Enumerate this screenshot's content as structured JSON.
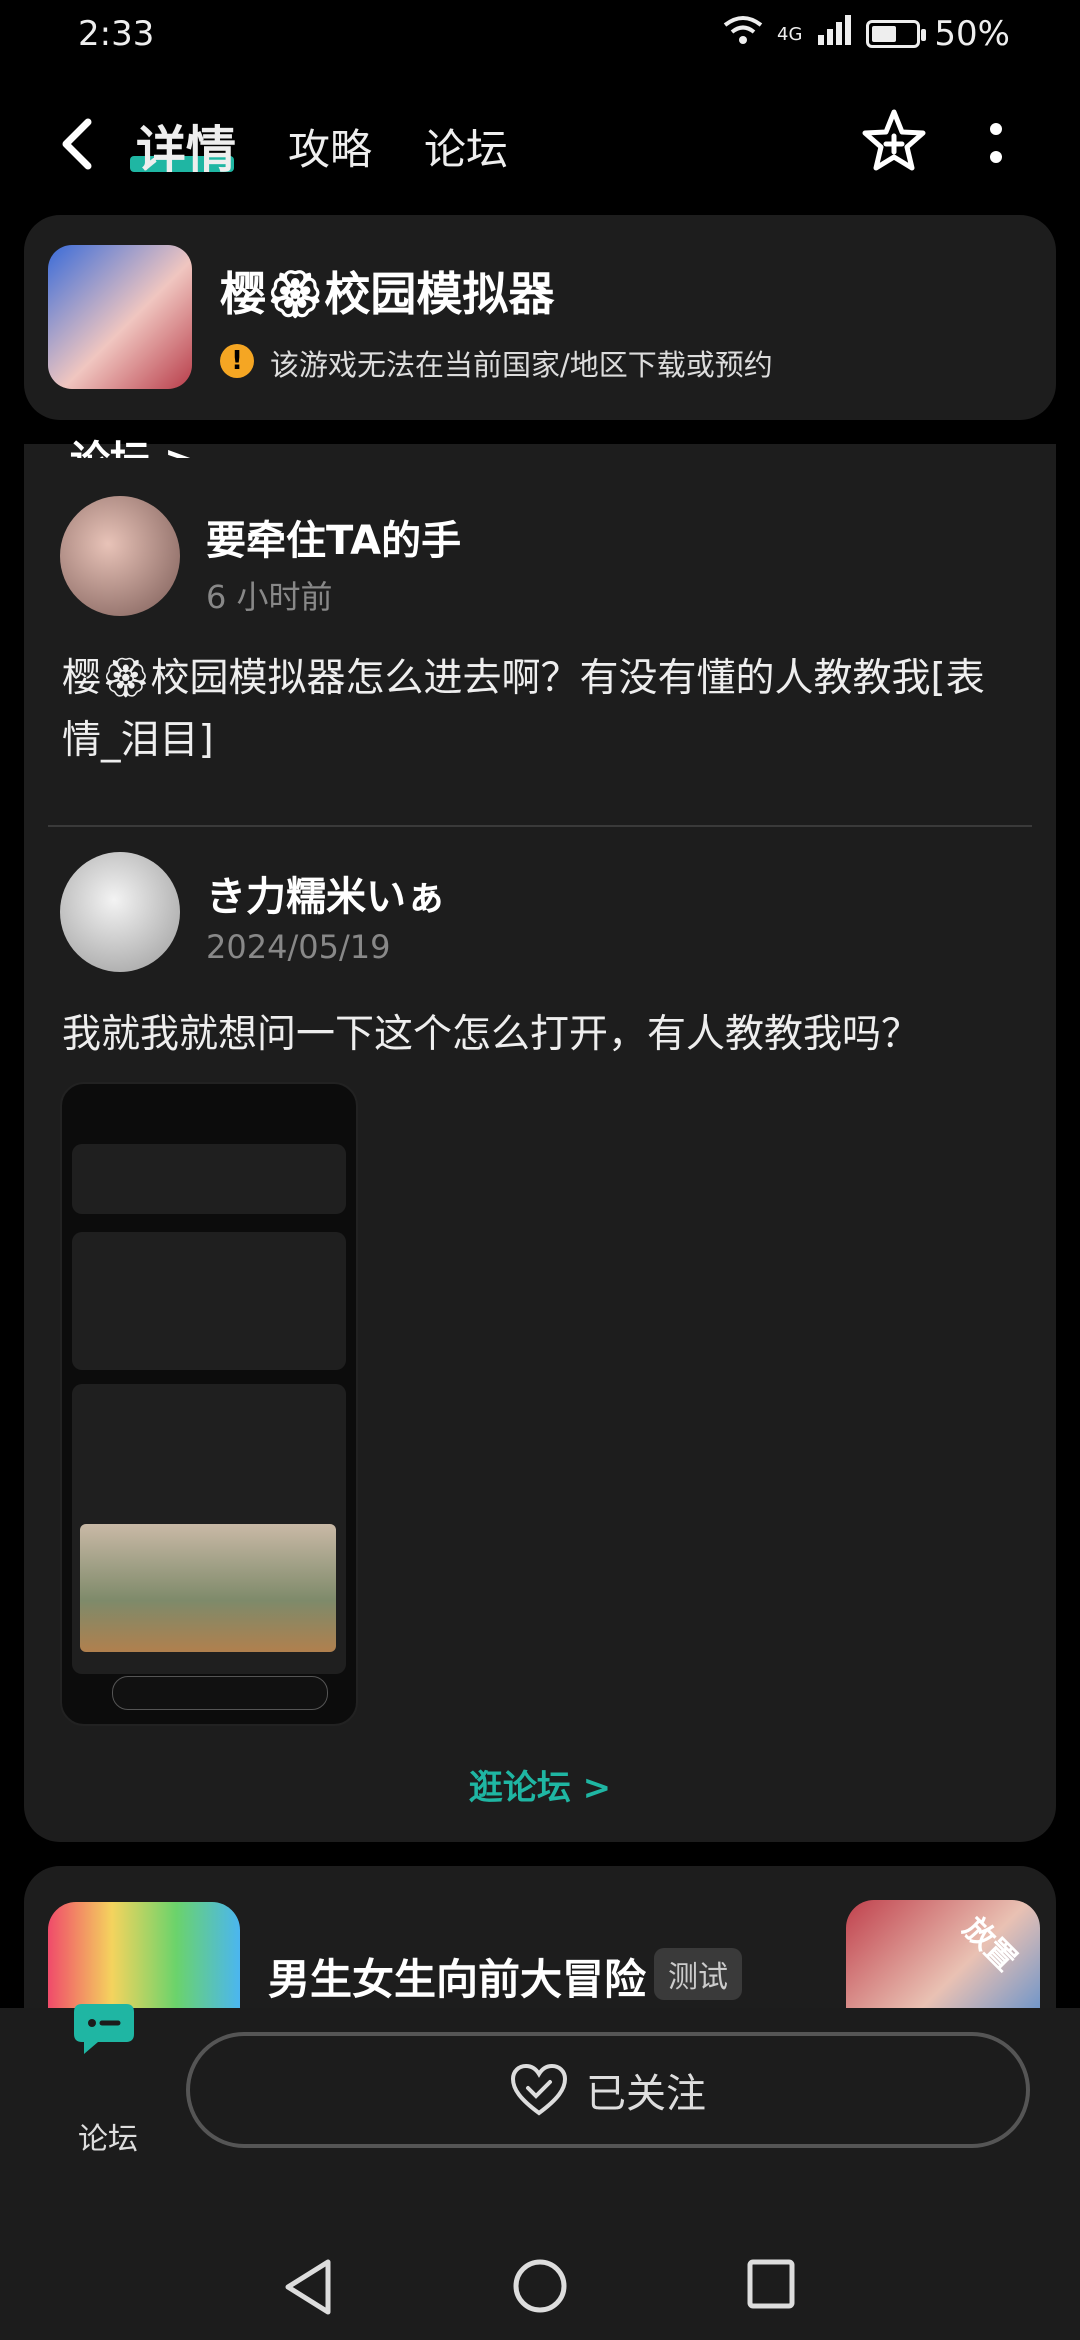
{
  "status": {
    "time": "2:33",
    "network": "4G",
    "battery": "50%"
  },
  "header": {
    "tabs": [
      {
        "label": "详情"
      },
      {
        "label": "攻略"
      },
      {
        "label": "论坛"
      }
    ],
    "active_tab": 0
  },
  "game": {
    "title": "樱🏵校园模拟器",
    "notice": "该游戏无法在当前国家/地区下载或预约"
  },
  "forum": {
    "section_label": "论坛 >",
    "posts": [
      {
        "author": "要牵住TA的手",
        "time": "6 小时前",
        "content": "樱🏵校园模拟器怎么进去啊？有没有懂的人教教我[表情_泪目]"
      },
      {
        "author": "き力糯米いぁ",
        "time": "2024/05/19",
        "content": "我就我就想问一下这个怎么打开，有人教教我吗？"
      }
    ],
    "more_label": "逛论坛 >"
  },
  "recommend": {
    "title": "男生女生向前大冒险",
    "badge": "测试",
    "right_label": "放置"
  },
  "bottom": {
    "forum_label": "论坛",
    "follow_label": "已关注"
  },
  "colors": {
    "accent": "#1fb6a3",
    "background": "#000000",
    "card": "#1d1d1d"
  }
}
